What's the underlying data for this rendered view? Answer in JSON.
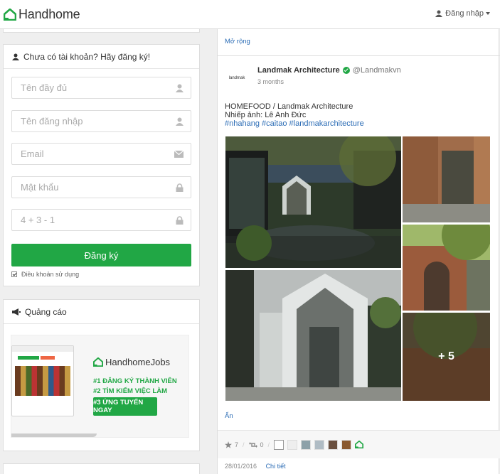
{
  "header": {
    "brand": "Handhome",
    "login_label": "Đăng nhập"
  },
  "signup": {
    "heading": "Chưa có tài khoản? Hãy đăng ký!",
    "fullname_placeholder": "Tên đầy đủ",
    "username_placeholder": "Tên đăng nhập",
    "email_placeholder": "Email",
    "password_placeholder": "Mật khẩu",
    "captcha_placeholder": "4 + 3 - 1",
    "submit_label": "Đăng ký",
    "terms_label": "Điều khoản sử dụng"
  },
  "ads": {
    "heading": "Quảng cáo",
    "jobs_brand": "HandhomeJobs",
    "step1": "#1 ĐĂNG KÝ THÀNH VIÊN",
    "step2": "#2 TÌM KIẾM VIỆC LÀM",
    "step3": "#3 ỨNG TUYỂN NGAY"
  },
  "feed": {
    "expand_label": "Mở rộng",
    "post": {
      "author": "Landmak Architecture",
      "handle": "@Landmakvn",
      "avatar_text": "landmak",
      "time": "3 months",
      "line1": "HOMEFOOD / Landmak Architecture",
      "line2": "Nhiếp ảnh: Lê Anh Đức",
      "tags": "#nhahang #caitao #landmakarchitecture",
      "more_count": "+ 5",
      "hide_label": "Ẩn",
      "likes": "7",
      "shares": "0",
      "date": "28/01/2016",
      "detail_label": "Chi tiết"
    }
  },
  "colors": {
    "brand_green": "#21a745",
    "link_blue": "#2b6cb5"
  }
}
